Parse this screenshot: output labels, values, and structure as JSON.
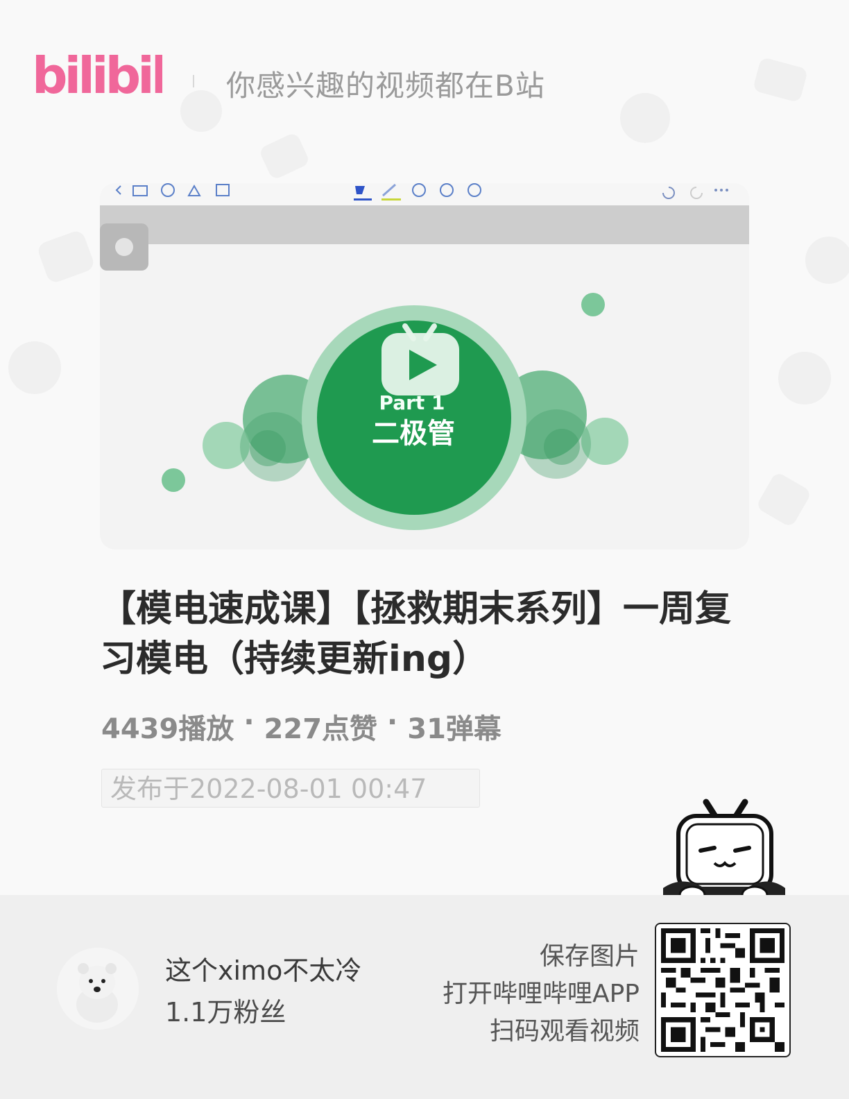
{
  "header": {
    "logo_text": "bilibili",
    "slogan": "你感兴趣的视频都在B站"
  },
  "cover": {
    "slide_part": "Part 1",
    "slide_topic": "二极管"
  },
  "video": {
    "title": "【模电速成课】【拯救期末系列】一周复习模电（持续更新ing）",
    "plays": "4439播放",
    "likes": "227点赞",
    "danmaku": "31弹幕",
    "separator": "·",
    "publish_time": "发布于2022-08-01 00:47"
  },
  "uploader": {
    "name": "这个ximo不太冷",
    "fans": "1.1万粉丝"
  },
  "share": {
    "line1": "保存图片",
    "line2": "打开哔哩哔哩APP",
    "line3": "扫码观看视频"
  },
  "colors": {
    "brand_pink": "#f0679a",
    "slide_green": "#1f9a50",
    "slide_green_light": "#7cc79a"
  }
}
